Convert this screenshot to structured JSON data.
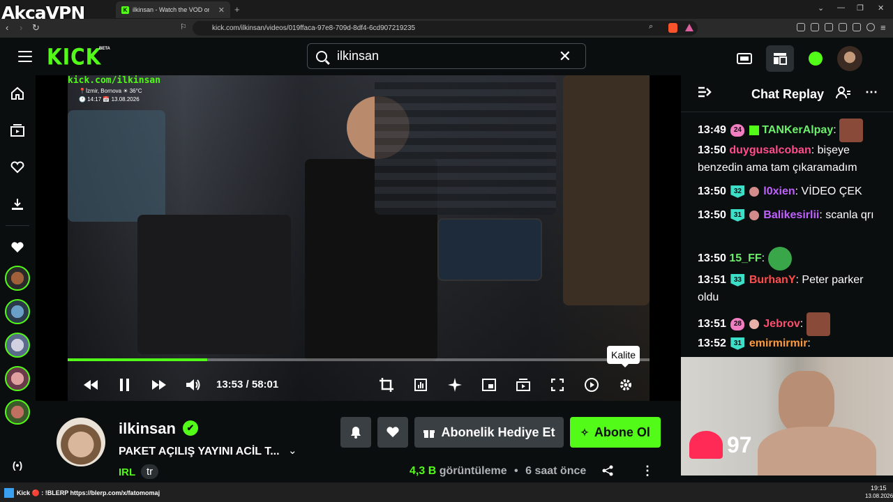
{
  "browser": {
    "vpn_logo": "AkcaVPN",
    "tab_title": "ilkinsan - Watch the VOD on Kick",
    "tab_close": "✕",
    "new_tab": "+",
    "url": "kick.com/ilkinsan/videos/019ffaca-97e8-709d-8df4-6cd907219235"
  },
  "header": {
    "logo": "KICK",
    "beta": "BETA",
    "search_value": "ilkinsan",
    "clear": "✕"
  },
  "video": {
    "overlay_url": "kick.com/ilkinsan",
    "overlay_location": "📍İzmir, Bornova ☀ 36°C",
    "overlay_time": "🕐 14:17 📅 13.08.2026",
    "current_time": "13:53 / 58:01",
    "progress_fraction": 0.24,
    "tooltip": "Kalite"
  },
  "info": {
    "channel_name": "ilkinsan",
    "verified": "✔",
    "title": "PAKET AÇILIŞ YAYINI ACİL T...",
    "category": "IRL",
    "language": "tr",
    "gift_label": "Abonelik Hediye Et",
    "subscribe_label": "Abone Ol",
    "views_count": "4,3 B",
    "views_label": "görüntüleme",
    "separator": "•",
    "time_ago": "6 saat önce"
  },
  "chat": {
    "title": "Chat Replay",
    "messages": [
      {
        "time": "13:49",
        "badge": "24",
        "user": "TANKerAlpay",
        "color": "#6cf06c",
        "text": ""
      },
      {
        "time": "13:50",
        "badge": "",
        "user": "duygusalcoban",
        "color": "#ff4d8a",
        "text": "bişeye benzedin ama tam çıkaramadım"
      },
      {
        "time": "13:50",
        "badge": "32",
        "user": "l0xien",
        "color": "#c061ff",
        "text": "VİDEO ÇEK"
      },
      {
        "time": "13:50",
        "badge": "31",
        "user": "Balikesirlii",
        "color": "#c061ff",
        "text": "scanla qrı"
      },
      {
        "time": "13:50",
        "badge": "",
        "user": "15_FF",
        "color": "#6cf06c",
        "text": ""
      },
      {
        "time": "13:51",
        "badge": "33",
        "user": "BurhanY",
        "color": "#ff4d4d",
        "text": "Peter parker oldu"
      },
      {
        "time": "13:51",
        "badge": "28",
        "user": "Jebrov",
        "color": "#ff4d6d",
        "text": ""
      },
      {
        "time": "13:52",
        "badge": "31",
        "user": "emirmirmir",
        "color": "#ff9a3c",
        "text": ""
      }
    ]
  },
  "webcam": {
    "heart_rate": "97"
  },
  "taskbar": {
    "clock": "19:15",
    "date": "13.08.2026",
    "ticker": "Kick 🔴 : !BLERP https://blerp.com/x/fatomomaj"
  },
  "colors": {
    "accent": "#53fc18",
    "bg": "#0b0e0f"
  }
}
